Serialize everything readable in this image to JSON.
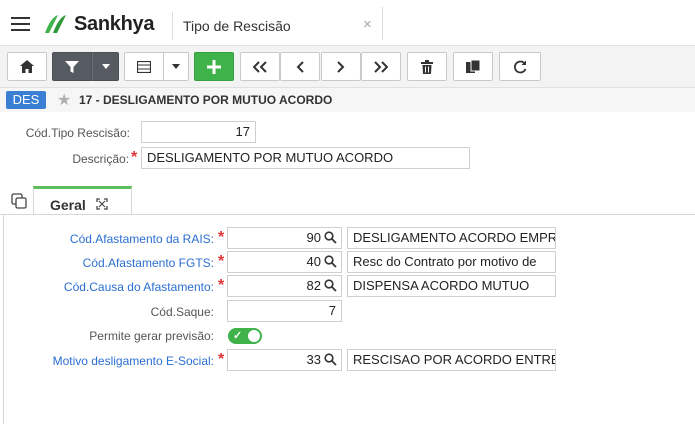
{
  "header": {
    "logo_text": "Sankhya",
    "tab_title": "Tipo de Rescisão",
    "tab_close": "×"
  },
  "toolbar": {
    "buttons": [
      "home-icon",
      "filter-icon",
      "chevron-down-icon",
      "grid-icon",
      "chevron-down-icon",
      "plus-icon",
      "first-icon",
      "previous-icon",
      "next-icon",
      "last-icon",
      "trash-icon",
      "copy-icon",
      "refresh-icon"
    ]
  },
  "breadcrumb": {
    "badge": "DES",
    "title": "17 - DESLIGAMENTO POR MUTUO ACORDO"
  },
  "form": {
    "cod_tipo_label": "Cód.Tipo Rescisão:",
    "cod_tipo_value": "17",
    "descricao_label": "Descrição:",
    "descricao_value": "DESLIGAMENTO POR MUTUO ACORDO",
    "required_mark": "*"
  },
  "tabs": {
    "geral_label": "Geral"
  },
  "geral": {
    "rais_label": "Cód.Afastamento da RAIS:",
    "rais_code": "90",
    "rais_desc": "DESLIGAMENTO ACORDO EMPR",
    "fgts_label": "Cód.Afastamento FGTS:",
    "fgts_code": "40",
    "fgts_desc": "Resc do Contrato por motivo de",
    "causa_label": "Cód.Causa do Afastamento:",
    "causa_code": "82",
    "causa_desc": "DISPENSA ACORDO MUTUO",
    "saque_label": "Cód.Saque:",
    "saque_value": "7",
    "previsao_label": "Permite gerar previsão:",
    "previsao_on": true,
    "esocial_label": "Motivo desligamento E-Social:",
    "esocial_code": "33",
    "esocial_desc": "RESCISAO POR ACORDO ENTRE"
  },
  "colors": {
    "accent_blue": "#3b7fd4",
    "link_blue": "#2b6fd1",
    "green": "#3fb34a",
    "required_red": "#d33"
  }
}
